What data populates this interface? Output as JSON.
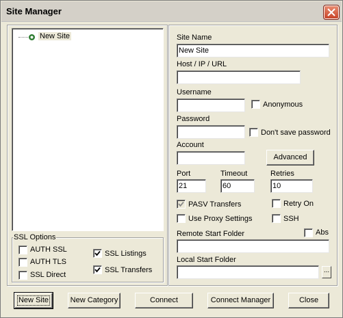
{
  "window": {
    "title": "Site Manager"
  },
  "tree": {
    "items": [
      {
        "label": "New Site"
      }
    ]
  },
  "ssl_options": {
    "legend": "SSL Options",
    "auth_ssl": {
      "label": "AUTH SSL",
      "checked": false
    },
    "auth_tls": {
      "label": "AUTH TLS",
      "checked": false
    },
    "ssl_direct": {
      "label": "SSL Direct",
      "checked": false
    },
    "ssl_listings": {
      "label": "SSL Listings",
      "checked": true
    },
    "ssl_transfers": {
      "label": "SSL Transfers",
      "checked": true
    }
  },
  "form": {
    "site_name": {
      "label": "Site Name",
      "value": "New Site"
    },
    "host": {
      "label": "Host / IP / URL",
      "value": ""
    },
    "username": {
      "label": "Username",
      "value": ""
    },
    "anonymous": {
      "label": "Anonymous",
      "checked": false
    },
    "password": {
      "label": "Password",
      "value": ""
    },
    "dont_save_password": {
      "label": "Don't save password",
      "checked": false
    },
    "account": {
      "label": "Account",
      "value": ""
    },
    "advanced_button": "Advanced",
    "port": {
      "label": "Port",
      "value": "21"
    },
    "timeout": {
      "label": "Timeout",
      "value": "60"
    },
    "retries": {
      "label": "Retries",
      "value": "10"
    },
    "pasv_transfers": {
      "label": "PASV Transfers",
      "checked": true,
      "disabled": true
    },
    "retry_on": {
      "label": "Retry On",
      "checked": false
    },
    "use_proxy": {
      "label": "Use Proxy Settings",
      "checked": false
    },
    "ssh": {
      "label": "SSH",
      "checked": false
    },
    "remote_start_folder": {
      "label": "Remote Start Folder",
      "value": ""
    },
    "abs": {
      "label": "Abs",
      "checked": false
    },
    "local_start_folder": {
      "label": "Local Start Folder",
      "value": ""
    },
    "browse_button": "..."
  },
  "buttons": {
    "new_site": "New Site",
    "new_category": "New Category",
    "connect": "Connect",
    "connect_manager": "Connect Manager",
    "close": "Close"
  },
  "colors": {
    "titlebar": "#d4d0c8",
    "window_bg": "#ece9d8",
    "close_button": "#c8452a"
  }
}
